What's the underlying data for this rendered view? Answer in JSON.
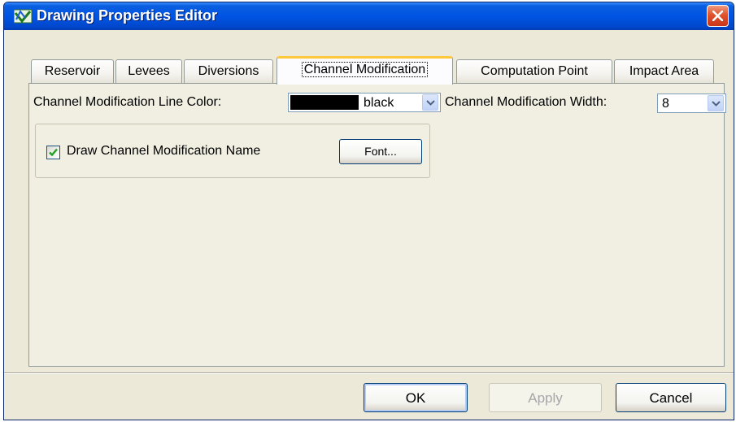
{
  "window": {
    "title": "Drawing Properties Editor",
    "icon": "app-map-icon",
    "close_icon": "close-icon"
  },
  "tabs": [
    {
      "label": "Reservoir",
      "selected": false
    },
    {
      "label": "Levees",
      "selected": false
    },
    {
      "label": "Diversions",
      "selected": false
    },
    {
      "label": "Channel Modification",
      "selected": true
    },
    {
      "label": "Computation Point",
      "selected": false
    },
    {
      "label": "Impact Area",
      "selected": false
    }
  ],
  "panel": {
    "line_color_label": "Channel Modification Line Color:",
    "line_color_value": "black",
    "line_color_swatch": "#000000",
    "width_label": "Channel Modification Width:",
    "width_value": "8",
    "draw_name_label": "Draw Channel Modification Name",
    "draw_name_checked": true,
    "font_button": "Font..."
  },
  "buttons": {
    "ok": "OK",
    "apply": "Apply",
    "cancel": "Cancel"
  },
  "colors": {
    "title_bar": "#0054e3",
    "dialog_bg": "#ece9d8",
    "selected_tab_accent": "#ffc83c",
    "checkmark": "#21a121",
    "close_button": "#e0522c"
  }
}
